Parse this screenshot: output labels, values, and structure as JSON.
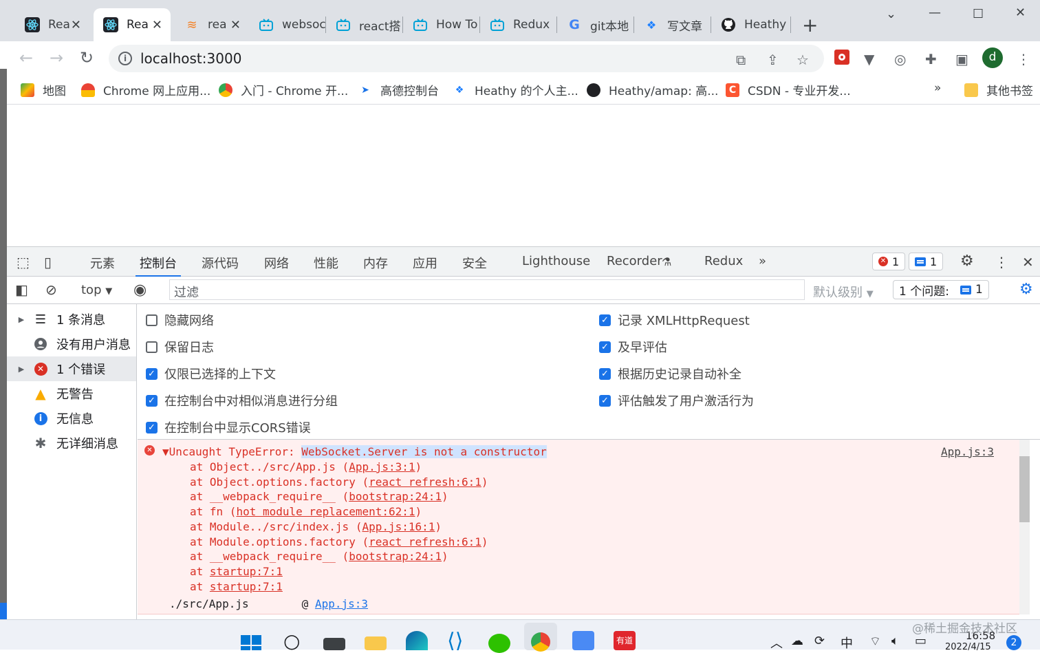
{
  "browser": {
    "tabs": [
      {
        "title": "Rea",
        "active": false
      },
      {
        "title": "Rea",
        "active": true
      },
      {
        "title": "rea",
        "active": false
      },
      {
        "title": "websoc",
        "active": false
      },
      {
        "title": "react搭",
        "active": false
      },
      {
        "title": "How To",
        "active": false
      },
      {
        "title": "Redux",
        "active": false
      },
      {
        "title": "git本地",
        "active": false
      },
      {
        "title": "写文章",
        "active": false
      },
      {
        "title": "Heathy",
        "active": false
      }
    ],
    "url": "localhost:3000",
    "profile_initial": "d",
    "bookmarks": [
      "地图",
      "Chrome 网上应用...",
      "入门 - Chrome 开...",
      "高德控制台",
      "Heathy 的个人主...",
      "Heathy/amap: 高...",
      "CSDN - 专业开发..."
    ],
    "bookmarks_overflow": "»",
    "other_bookmarks": "其他书签"
  },
  "devtools": {
    "tabs": [
      "元素",
      "控制台",
      "源代码",
      "网络",
      "性能",
      "内存",
      "应用",
      "安全",
      "Lighthouse",
      "Recorder",
      "Redux"
    ],
    "active_tab": "控制台",
    "more_tabs": "»",
    "error_count": "1",
    "message_count": "1",
    "filter": {
      "context": "top",
      "placeholder": "过滤",
      "level": "默认级别",
      "issues_label": "1 个问题:",
      "issues_count": "1"
    },
    "sidebar": [
      {
        "label": "1 条消息"
      },
      {
        "label": "没有用户消息"
      },
      {
        "label": "1 个错误"
      },
      {
        "label": "无警告"
      },
      {
        "label": "无信息"
      },
      {
        "label": "无详细消息"
      }
    ],
    "settings": {
      "left": [
        {
          "label": "隐藏网络",
          "checked": false
        },
        {
          "label": "保留日志",
          "checked": false
        },
        {
          "label": "仅限已选择的上下文",
          "checked": true
        },
        {
          "label": "在控制台中对相似消息进行分组",
          "checked": true
        },
        {
          "label": "在控制台中显示CORS错误",
          "checked": true
        }
      ],
      "right": [
        {
          "label": "记录 XMLHttpRequest",
          "checked": true
        },
        {
          "label": "及早评估",
          "checked": true
        },
        {
          "label": "根据历史记录自动补全",
          "checked": true
        },
        {
          "label": "评估触发了用户激活行为",
          "checked": true
        }
      ]
    },
    "console": {
      "error_prefix": "Uncaught TypeError: ",
      "error_message": "WebSocket.Server is not a constructor",
      "source": "App.js:3",
      "stack": [
        {
          "fn": "at Object../src/App.js (",
          "loc": "App.js:3:1",
          "end": ")"
        },
        {
          "fn": "at Object.options.factory (",
          "loc": "react refresh:6:1",
          "end": ")"
        },
        {
          "fn": "at __webpack_require__ (",
          "loc": "bootstrap:24:1",
          "end": ")"
        },
        {
          "fn": "at fn (",
          "loc": "hot module replacement:62:1",
          "end": ")"
        },
        {
          "fn": "at Module../src/index.js (",
          "loc": "App.js:16:1",
          "end": ")"
        },
        {
          "fn": "at Module.options.factory (",
          "loc": "react refresh:6:1",
          "end": ")"
        },
        {
          "fn": "at __webpack_require__ (",
          "loc": "bootstrap:24:1",
          "end": ")"
        },
        {
          "fn": "at ",
          "loc": "startup:7:1",
          "end": ""
        },
        {
          "fn": "at ",
          "loc": "startup:7:1",
          "end": ""
        }
      ],
      "footer_file": "./src/App.js",
      "footer_at": "@",
      "footer_link": "App.js:3"
    }
  },
  "taskbar": {
    "ime": "中",
    "time": "16:58",
    "date": "2022/4/15",
    "notifications": "2",
    "watermark": "@稀土掘金技术社区"
  },
  "colors": {
    "accent": "#1a73e8",
    "error": "#d93025",
    "error_bg": "#fff0f0"
  }
}
